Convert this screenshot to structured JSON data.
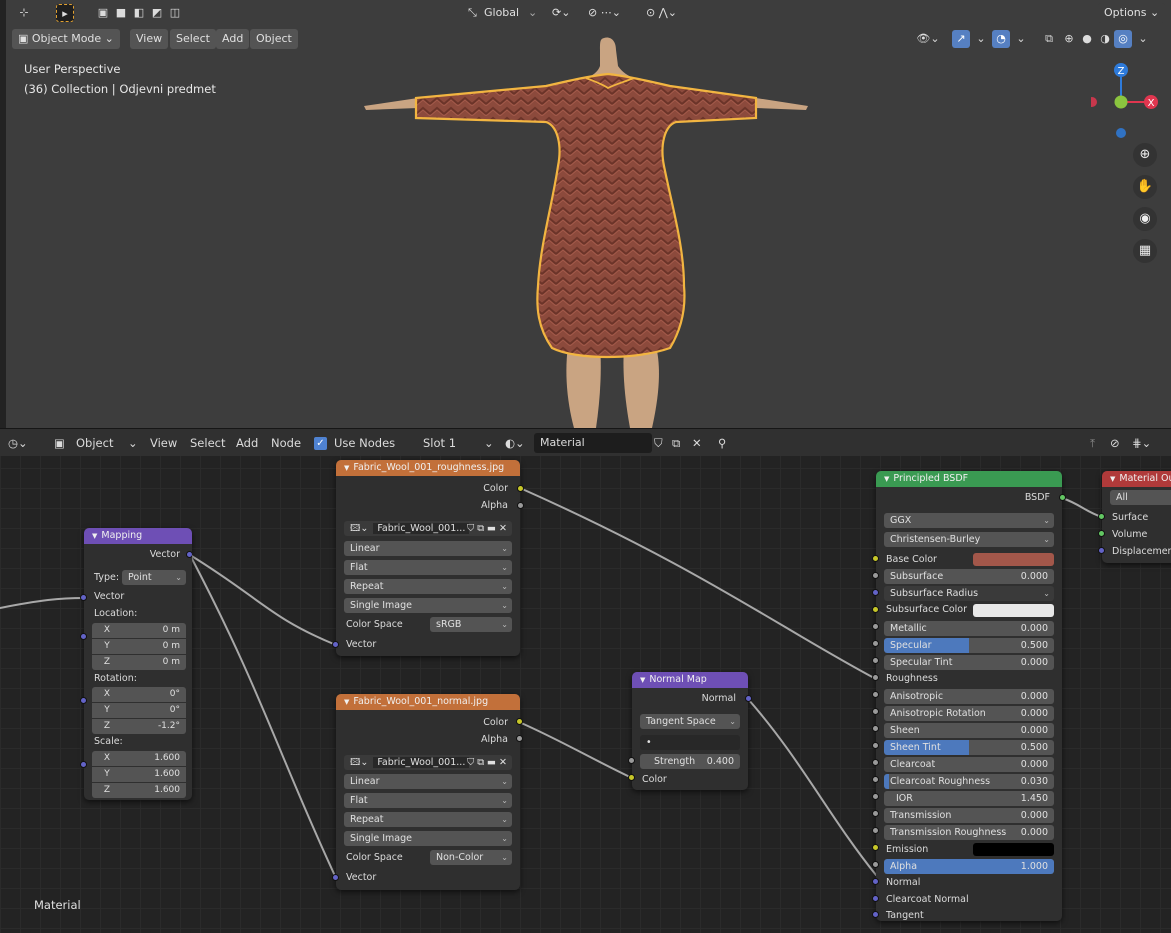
{
  "viewport": {
    "header1": {
      "transform_orientation": "Global",
      "options_label": "Options"
    },
    "header2": {
      "mode": "Object Mode",
      "menus": [
        "View",
        "Select",
        "Add",
        "Object"
      ]
    },
    "info": {
      "perspective": "User Perspective",
      "collection": "(36) Collection | Odjevni predmet"
    },
    "gizmo": {
      "z": "Z",
      "y": "Y",
      "x": "X"
    },
    "colors": {
      "x_axis": "#e0364f",
      "y_axis": "#8bc53f",
      "z_axis": "#2e7bdb",
      "outline": "#f2b541",
      "fabric": "#8c4a3c",
      "skin": "#c9a482"
    }
  },
  "node_editor": {
    "header": {
      "editor_type": "Object",
      "menus": [
        "View",
        "Select",
        "Add",
        "Node"
      ],
      "use_nodes_label": "Use Nodes",
      "use_nodes_checked": true,
      "slot": "Slot 1",
      "material_name": "Material"
    },
    "footer_label": "Material",
    "mapping": {
      "title": "Mapping",
      "out_vector": "Vector",
      "type_label": "Type:",
      "type_value": "Point",
      "in_vector": "Vector",
      "location_label": "Location:",
      "location": [
        [
          "X",
          "0 m"
        ],
        [
          "Y",
          "0 m"
        ],
        [
          "Z",
          "0 m"
        ]
      ],
      "rotation_label": "Rotation:",
      "rotation": [
        [
          "X",
          "0°"
        ],
        [
          "Y",
          "0°"
        ],
        [
          "Z",
          "-1.2°"
        ]
      ],
      "scale_label": "Scale:",
      "scale": [
        [
          "X",
          "1.600"
        ],
        [
          "Y",
          "1.600"
        ],
        [
          "Z",
          "1.600"
        ]
      ]
    },
    "tex_rough": {
      "title": "Fabric_Wool_001_roughness.jpg",
      "out_color": "Color",
      "out_alpha": "Alpha",
      "image_name": "Fabric_Wool_001...",
      "interpolation": "Linear",
      "projection": "Flat",
      "extension": "Repeat",
      "source": "Single Image",
      "color_space_label": "Color Space",
      "color_space": "sRGB",
      "in_vector": "Vector"
    },
    "tex_normal": {
      "title": "Fabric_Wool_001_normal.jpg",
      "out_color": "Color",
      "out_alpha": "Alpha",
      "image_name": "Fabric_Wool_001...",
      "interpolation": "Linear",
      "projection": "Flat",
      "extension": "Repeat",
      "source": "Single Image",
      "color_space_label": "Color Space",
      "color_space": "Non-Color",
      "in_vector": "Vector"
    },
    "normal_map": {
      "title": "Normal Map",
      "out_normal": "Normal",
      "space": "Tangent Space",
      "uv_map": "•",
      "strength_label": "Strength",
      "strength": "0.400",
      "in_color": "Color"
    },
    "bsdf": {
      "title": "Principled BSDF",
      "out_bsdf": "BSDF",
      "distribution": "GGX",
      "subsurface_method": "Christensen-Burley",
      "base_color_label": "Base Color",
      "base_color": "#a3574a",
      "subsurface_label": "Subsurface",
      "subsurface": "0.000",
      "subsurface_radius_label": "Subsurface Radius",
      "subsurface_color_label": "Subsurface Color",
      "subsurface_color": "#e8e8e8",
      "metallic_label": "Metallic",
      "metallic": "0.000",
      "specular_label": "Specular",
      "specular": "0.500",
      "specular_fill": 0.5,
      "specular_tint_label": "Specular Tint",
      "specular_tint": "0.000",
      "roughness_label": "Roughness",
      "anisotropic_label": "Anisotropic",
      "anisotropic": "0.000",
      "anisotropic_rotation_label": "Anisotropic Rotation",
      "anisotropic_rotation": "0.000",
      "sheen_label": "Sheen",
      "sheen": "0.000",
      "sheen_tint_label": "Sheen Tint",
      "sheen_tint": "0.500",
      "sheen_tint_fill": 0.5,
      "clearcoat_label": "Clearcoat",
      "clearcoat": "0.000",
      "clearcoat_roughness_label": "Clearcoat Roughness",
      "clearcoat_roughness": "0.030",
      "clearcoat_roughness_fill": 0.03,
      "ior_label": "IOR",
      "ior": "1.450",
      "transmission_label": "Transmission",
      "transmission": "0.000",
      "transmission_roughness_label": "Transmission Roughness",
      "transmission_roughness": "0.000",
      "emission_label": "Emission",
      "emission_color": "#000000",
      "alpha_label": "Alpha",
      "alpha": "1.000",
      "alpha_fill": 1.0,
      "normal_label": "Normal",
      "clearcoat_normal_label": "Clearcoat Normal",
      "tangent_label": "Tangent"
    },
    "output": {
      "title": "Material Output",
      "target": "All",
      "surface_label": "Surface",
      "volume_label": "Volume",
      "displacement_label": "Displacement"
    }
  }
}
